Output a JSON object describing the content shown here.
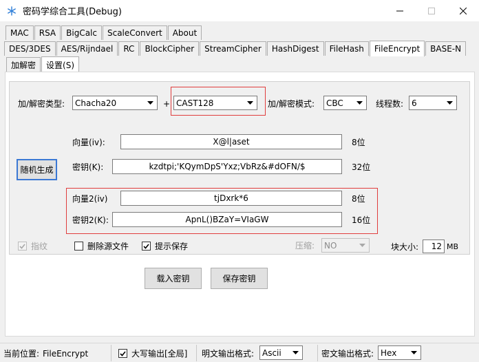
{
  "window": {
    "title": "密码学综合工具(Debug)"
  },
  "tabs_row1": [
    "MAC",
    "RSA",
    "BigCalc",
    "ScaleConvert",
    "About"
  ],
  "tabs_row2": [
    "DES/3DES",
    "AES/Rijndael",
    "RC",
    "BlockCipher",
    "StreamCipher",
    "HashDigest",
    "FileHash",
    "FileEncrypt",
    "BASE-N"
  ],
  "tabs_row2_active": "FileEncrypt",
  "tabs_row3": [
    "加解密",
    "设置(S)"
  ],
  "tabs_row3_active": "设置(S)",
  "settings": {
    "cipher_type_label": "加/解密类型:",
    "cipher_type_value": "Chacha20",
    "plus": "+",
    "cipher2_value": "CAST128",
    "mode_label": "加/解密模式:",
    "mode_value": "CBC",
    "threads_label": "线程数:",
    "threads_value": "6",
    "iv_label": "向量(iv):",
    "iv_value": "X@l|aset",
    "iv_bits": "8位",
    "random_button": "随机生成",
    "key_label": "密钥(K):",
    "key_value": "kzdtpi;'KQymDpS'Yxz;VbRz&#dOFN/$",
    "key_bits": "32位",
    "iv2_label": "向量2(iv)",
    "iv2_value": "tjDxrk*6",
    "iv2_bits": "8位",
    "key2_label": "密钥2(K):",
    "key2_value": "ApnL()BZaY=VIaGW",
    "key2_bits": "16位",
    "fingerprint_label": "指纹",
    "delete_source_label": "删除源文件",
    "prompt_save_label": "提示保存",
    "compress_label": "压缩:",
    "compress_value": "NO",
    "block_size_label": "块大小:",
    "block_size_value": "12",
    "block_size_unit": "MB",
    "load_key_button": "载入密钥",
    "save_key_button": "保存密钥"
  },
  "status": {
    "location_label": "当前位置:",
    "location_value": "FileEncrypt",
    "uppercase_label": "大写输出[全局]",
    "plain_format_label": "明文输出格式:",
    "plain_format_value": "Ascii",
    "cipher_format_label": "密文输出格式:",
    "cipher_format_value": "Hex"
  },
  "colors": {
    "highlight_box": "#e03c3c"
  }
}
